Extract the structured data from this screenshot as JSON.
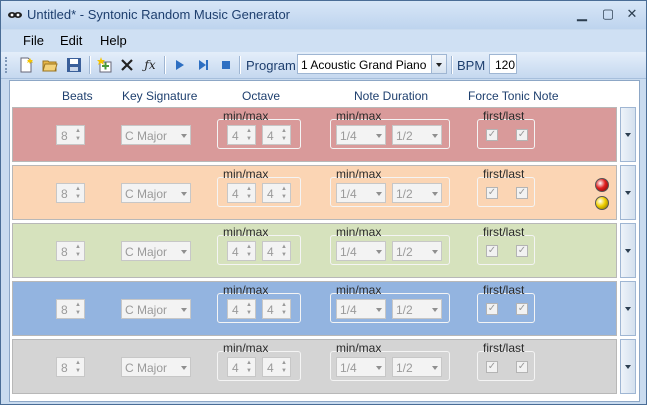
{
  "window": {
    "title": "Untitled* - Syntonic Random Music Generator",
    "minimize_glyph": "▁",
    "maximize_glyph": "▢",
    "close_glyph": "✕"
  },
  "menu": {
    "items": [
      "File",
      "Edit",
      "Help"
    ]
  },
  "toolbar": {
    "icons": [
      "new-file-icon",
      "open-folder-icon",
      "save-disk-icon",
      "add-track-icon",
      "delete-icon",
      "function-icon",
      "play-icon",
      "step-icon",
      "stop-icon"
    ],
    "function_glyph": "ƒx",
    "program_label": "Program",
    "program_value": "1 Acoustic Grand Piano",
    "bpm_label": "BPM",
    "bpm_value": "120"
  },
  "headers": {
    "beats": "Beats",
    "key_signature": "Key Signature",
    "octave": "Octave",
    "note_duration": "Note Duration",
    "force_tonic": "Force Tonic Note"
  },
  "tracks": [
    {
      "color": "#d99a9a",
      "beats": "8",
      "key": "C Major",
      "octave_group": "min/max",
      "octave_min": "4",
      "octave_max": "4",
      "duration_group": "min/max",
      "duration_min": "1/4",
      "duration_max": "1/2",
      "tonic_group": "first/last",
      "tonic_first": "✓",
      "tonic_last": "✓"
    },
    {
      "color": "#fbd5b4",
      "beats": "8",
      "key": "C Major",
      "octave_group": "min/max",
      "octave_min": "4",
      "octave_max": "4",
      "duration_group": "min/max",
      "duration_min": "1/4",
      "duration_max": "1/2",
      "tonic_group": "first/last",
      "tonic_first": "✓",
      "tonic_last": "✓"
    },
    {
      "color": "#d6e2bd",
      "beats": "8",
      "key": "C Major",
      "octave_group": "min/max",
      "octave_min": "4",
      "octave_max": "4",
      "duration_group": "min/max",
      "duration_min": "1/4",
      "duration_max": "1/2",
      "tonic_group": "first/last",
      "tonic_first": "✓",
      "tonic_last": "✓"
    },
    {
      "color": "#93b4e0",
      "beats": "8",
      "key": "C Major",
      "octave_group": "min/max",
      "octave_min": "4",
      "octave_max": "4",
      "duration_group": "min/max",
      "duration_min": "1/4",
      "duration_max": "1/2",
      "tonic_group": "first/last",
      "tonic_first": "✓",
      "tonic_last": "✓"
    },
    {
      "color": "#d4d4d4",
      "beats": "8",
      "key": "C Major",
      "octave_group": "min/max",
      "octave_min": "4",
      "octave_max": "4",
      "duration_group": "min/max",
      "duration_min": "1/4",
      "duration_max": "1/2",
      "tonic_group": "first/last",
      "tonic_first": "✓",
      "tonic_last": "✓"
    }
  ],
  "track_status_lights": {
    "colors": [
      "#e02020",
      "#f0d000"
    ]
  }
}
